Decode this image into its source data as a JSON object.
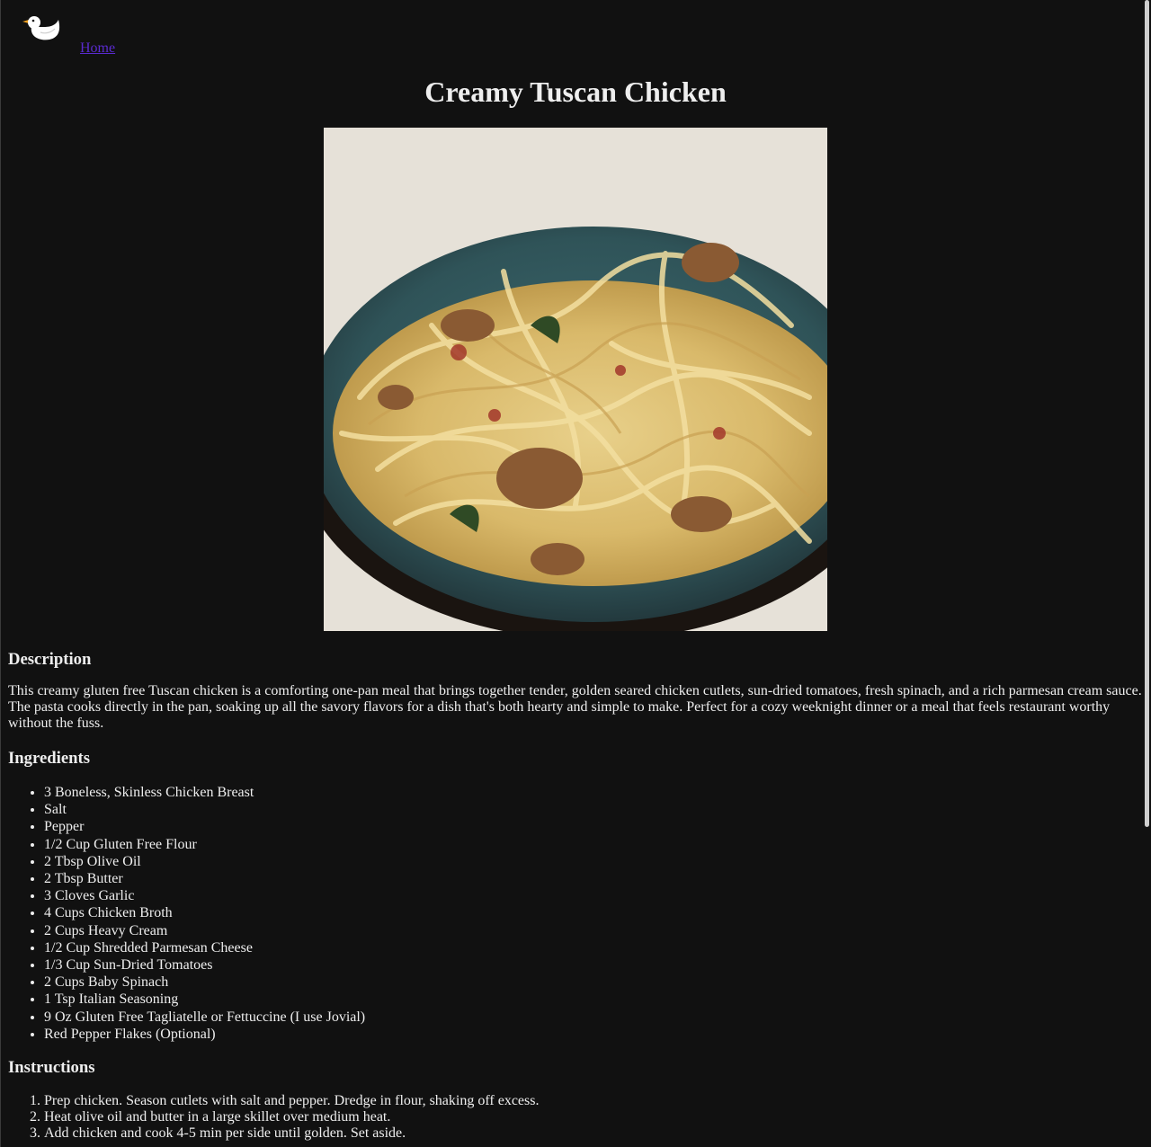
{
  "header": {
    "logo_icon": "duck-logo-icon",
    "home_label": "Home"
  },
  "recipe": {
    "title": "Creamy Tuscan Chicken",
    "image_icon": "pasta-dish-photo",
    "description_heading": "Description",
    "description": "This creamy gluten free Tuscan chicken is a comforting one-pan meal that brings together tender, golden seared chicken cutlets, sun-dried tomatoes, fresh spinach, and a rich parmesan cream sauce. The pasta cooks directly in the pan, soaking up all the savory flavors for a dish that's both hearty and simple to make. Perfect for a cozy weeknight dinner or a meal that feels restaurant worthy without the fuss.",
    "ingredients_heading": "Ingredients",
    "ingredients": [
      "3 Boneless, Skinless Chicken Breast",
      "Salt",
      "Pepper",
      "1/2 Cup Gluten Free Flour",
      "2 Tbsp Olive Oil",
      "2 Tbsp Butter",
      "3 Cloves Garlic",
      "4 Cups Chicken Broth",
      "2 Cups Heavy Cream",
      "1/2 Cup Shredded Parmesan Cheese",
      "1/3 Cup Sun-Dried Tomatoes",
      "2 Cups Baby Spinach",
      "1 Tsp Italian Seasoning",
      "9 Oz Gluten Free Tagliatelle or Fettuccine (I use Jovial)",
      "Red Pepper Flakes (Optional)"
    ],
    "instructions_heading": "Instructions",
    "instructions": [
      "Prep chicken. Season cutlets with salt and pepper. Dredge in flour, shaking off excess.",
      "Heat olive oil and butter in a large skillet over medium heat.",
      "Add chicken and cook 4-5 min per side until golden. Set aside."
    ]
  },
  "colors": {
    "background": "#111111",
    "text": "#eeeeee",
    "link": "#5a2bd0"
  }
}
